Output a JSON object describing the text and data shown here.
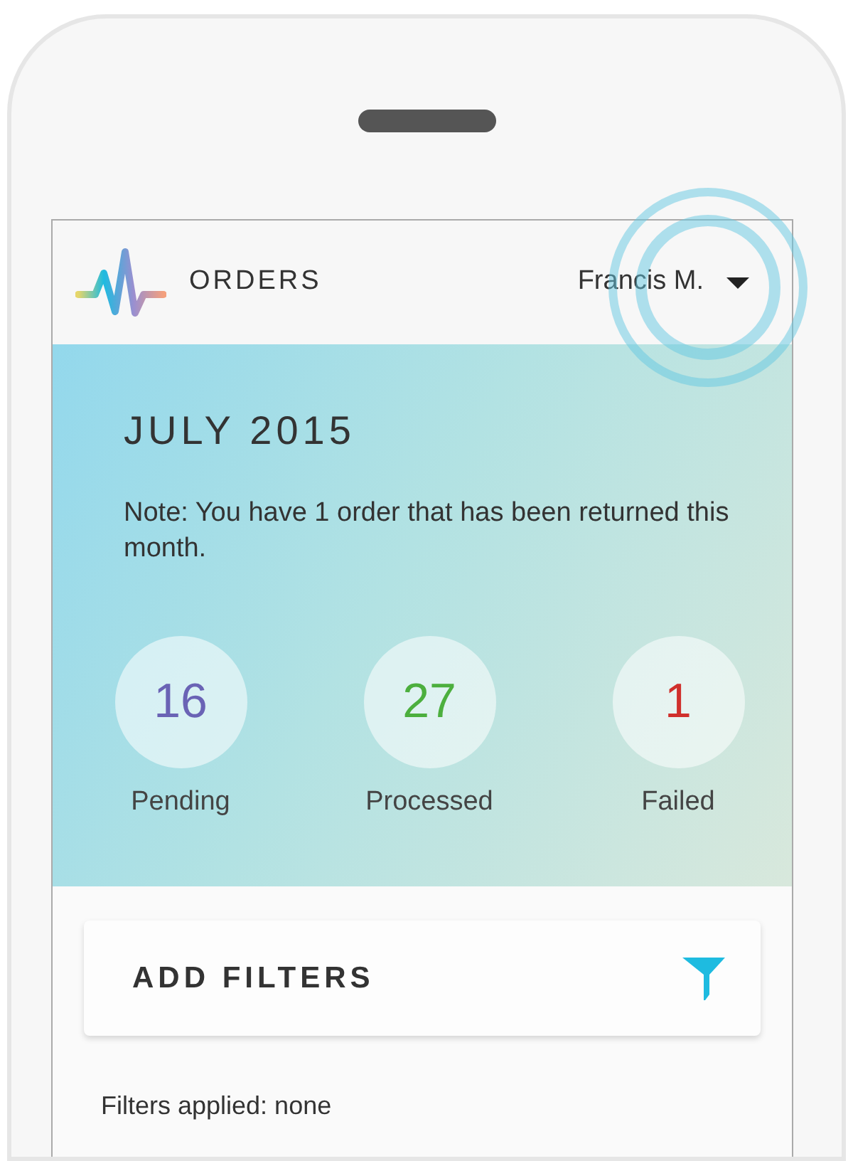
{
  "header": {
    "title": "ORDERS",
    "user": "Francis M."
  },
  "summary": {
    "month": "JULY 2015",
    "note": "Note: You have 1 order that has been returned this month.",
    "stats": [
      {
        "value": "16",
        "label": "Pending",
        "color": "#6a63b5"
      },
      {
        "value": "27",
        "label": "Processed",
        "color": "#4caf3e"
      },
      {
        "value": "1",
        "label": "Failed",
        "color": "#d0302c"
      }
    ]
  },
  "filters": {
    "button": "ADD FILTERS",
    "applied": "Filters applied: none"
  }
}
